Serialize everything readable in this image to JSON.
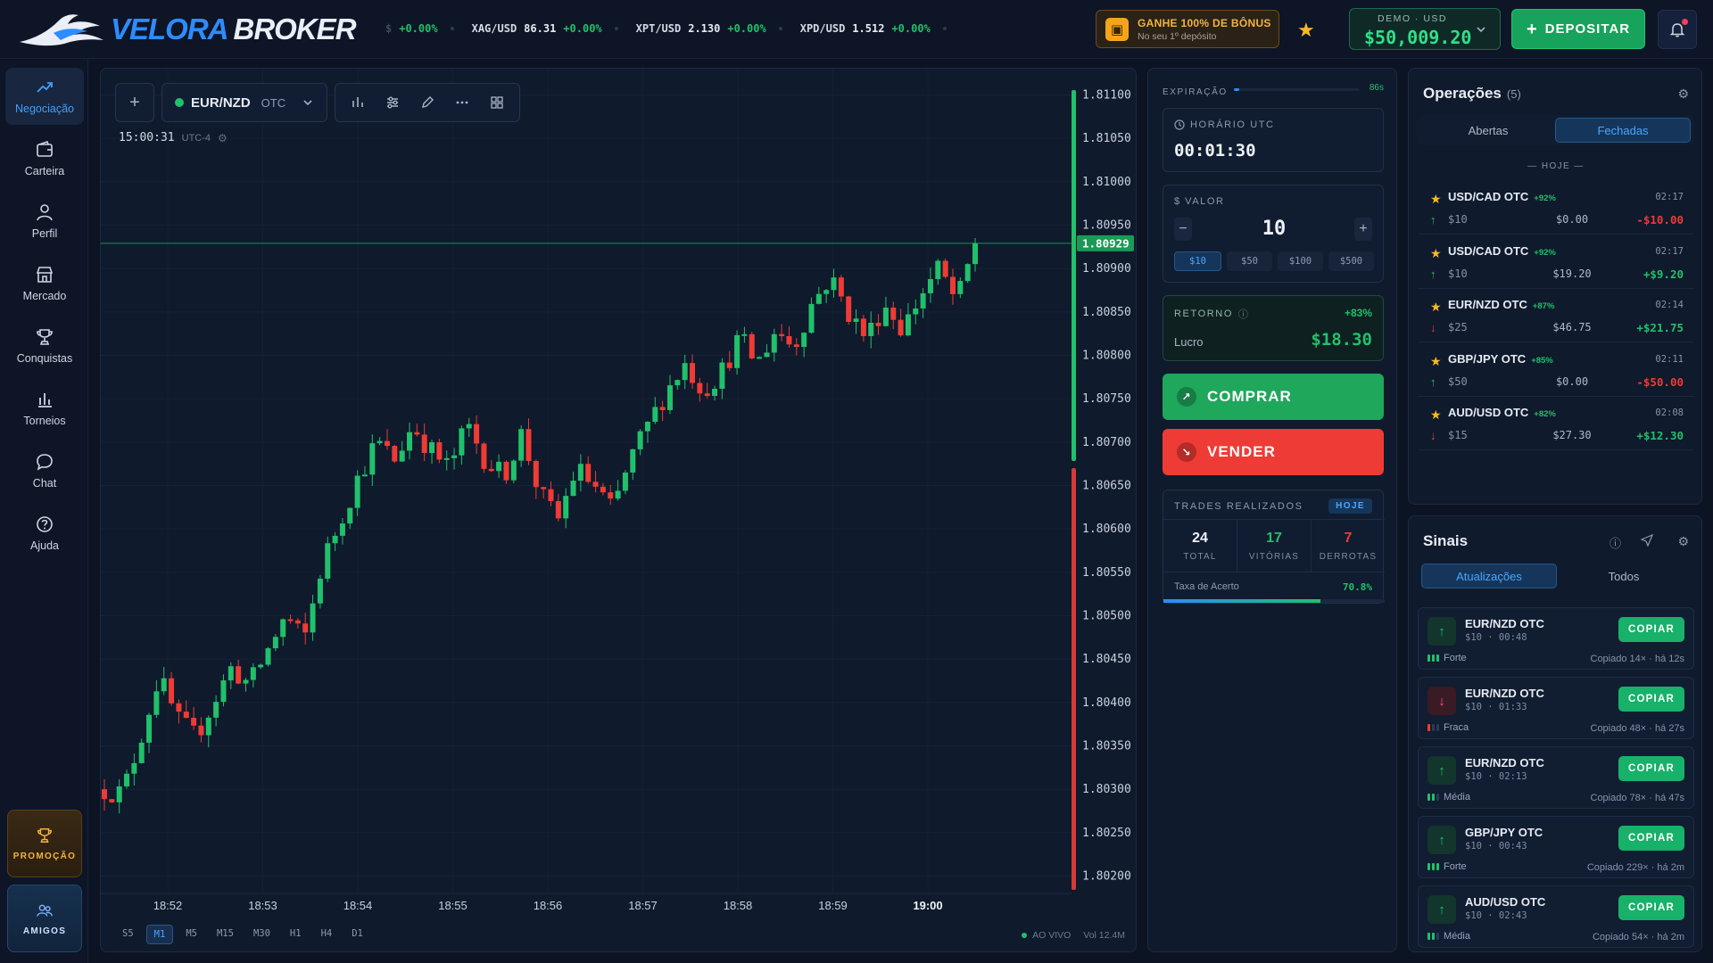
{
  "brand": {
    "part1": "VELORA",
    "part2": "BROKER"
  },
  "ticker": [
    {
      "symbol": "",
      "price": "$",
      "change": "+0.00%"
    },
    {
      "symbol": "XAG/USD",
      "price": "86.31",
      "change": "+0.00%"
    },
    {
      "symbol": "XPT/USD",
      "price": "2.130",
      "change": "+0.00%"
    },
    {
      "symbol": "XPD/USD",
      "price": "1.512",
      "change": "+0.00%"
    }
  ],
  "bonus": {
    "title": "GANHE 100% DE BÔNUS",
    "subtitle": "No seu 1º depósito"
  },
  "account": {
    "label": "DEMO · USD",
    "balance": "$50,009.20"
  },
  "deposit_label": "DEPOSITAR",
  "nav": [
    {
      "label": "Negociação",
      "icon": "trend-up-icon",
      "active": true
    },
    {
      "label": "Carteira",
      "icon": "wallet-icon"
    },
    {
      "label": "Perfil",
      "icon": "user-icon"
    },
    {
      "label": "Mercado",
      "icon": "store-icon"
    },
    {
      "label": "Conquistas",
      "icon": "trophy-icon"
    },
    {
      "label": "Torneios",
      "icon": "bar-chart-icon"
    },
    {
      "label": "Chat",
      "icon": "chat-icon"
    },
    {
      "label": "Ajuda",
      "icon": "help-icon"
    }
  ],
  "promo": {
    "promotion": "PROMOÇÃO",
    "friends": "AMIGOS"
  },
  "chart_toolbar": {
    "pair": "EUR/NZD",
    "market": "OTC"
  },
  "chart_clock": {
    "time": "15:00:31",
    "tz": "UTC-4"
  },
  "timeframes": [
    "S5",
    "M1",
    "M5",
    "M15",
    "M30",
    "H1",
    "H4",
    "D1"
  ],
  "active_timeframe": "M1",
  "live": {
    "label": "AO VIVO",
    "volume": "Vol 12.4M"
  },
  "chart_data": {
    "type": "candlestick",
    "x_ticks": [
      "18:52",
      "18:53",
      "18:54",
      "18:55",
      "18:56",
      "18:57",
      "18:58",
      "18:59",
      "19:00"
    ],
    "y_ticks": [
      "1.81100",
      "1.81050",
      "1.81000",
      "1.80950",
      "1.80900",
      "1.80850",
      "1.80800",
      "1.80750",
      "1.80700",
      "1.80650",
      "1.80600",
      "1.80550",
      "1.80500",
      "1.80450",
      "1.80400",
      "1.80350",
      "1.80300",
      "1.80250",
      "1.80200"
    ],
    "ylim": [
      1.8018,
      1.8112
    ],
    "current_price": "1.80929",
    "current_value": 1.80929,
    "buy_ratio": 0.47,
    "close_path": [
      1.803,
      1.80295,
      1.8036,
      1.8043,
      1.8038,
      1.8036,
      1.804,
      1.8044,
      1.8042,
      1.8046,
      1.805,
      1.8047,
      1.8056,
      1.8061,
      1.8066,
      1.807,
      1.8068,
      1.8072,
      1.8069,
      1.8067,
      1.8072,
      1.8068,
      1.8066,
      1.8071,
      1.8064,
      1.8061,
      1.8067,
      1.8065,
      1.8062,
      1.8068,
      1.8072,
      1.8076,
      1.8079,
      1.8076,
      1.8078,
      1.8082,
      1.8079,
      1.8083,
      1.8081,
      1.8086,
      1.8089,
      1.8085,
      1.8082,
      1.8086,
      1.8083,
      1.8087,
      1.809,
      1.8086,
      1.80929
    ]
  },
  "trade": {
    "expiration_label": "EXPIRAÇÃO",
    "expiration_value": "86s",
    "expiration_fill": 0.04,
    "utc_label": "HORÁRIO UTC",
    "utc_time": "00:01:30",
    "value_label": "VALOR",
    "amount": "10",
    "presets": [
      "$10",
      "$50",
      "$100",
      "$500"
    ],
    "return_label": "RETORNO",
    "return_pct": "+83%",
    "profit_label": "Lucro",
    "profit": "$18.30",
    "buy": "COMPRAR",
    "sell": "VENDER",
    "stats_label": "TRADES REALIZADOS",
    "stats_period": "HOJE",
    "total": "24",
    "total_label": "TOTAL",
    "wins": "17",
    "wins_label": "VITÓRIAS",
    "losses": "7",
    "losses_label": "DERROTAS",
    "accuracy_label": "Taxa de Acerto",
    "accuracy": "70.8%",
    "accuracy_fill": 0.708
  },
  "operations": {
    "title": "Operações",
    "count": "(5)",
    "tabs": [
      "Abertas",
      "Fechadas"
    ],
    "active_tab": "Fechadas",
    "day": "— HOJE —",
    "items": [
      {
        "pair": "USD/CAD OTC",
        "pct": "+92%",
        "time": "02:17",
        "dir": "up",
        "amount": "$10",
        "payout": "$0.00",
        "result": "-$10.00"
      },
      {
        "pair": "USD/CAD OTC",
        "pct": "+92%",
        "time": "02:17",
        "dir": "up",
        "amount": "$10",
        "payout": "$19.20",
        "result": "+$9.20"
      },
      {
        "pair": "EUR/NZD OTC",
        "pct": "+87%",
        "time": "02:14",
        "dir": "down",
        "amount": "$25",
        "payout": "$46.75",
        "result": "+$21.75"
      },
      {
        "pair": "GBP/JPY OTC",
        "pct": "+85%",
        "time": "02:11",
        "dir": "up",
        "amount": "$50",
        "payout": "$0.00",
        "result": "-$50.00"
      },
      {
        "pair": "AUD/USD OTC",
        "pct": "+82%",
        "time": "02:08",
        "dir": "down",
        "amount": "$15",
        "payout": "$27.30",
        "result": "+$12.30"
      }
    ]
  },
  "signals": {
    "title": "Sinais",
    "tabs": [
      "Atualizações",
      "Todos"
    ],
    "active_tab": "Atualizações",
    "copy_label": "COPIAR",
    "items": [
      {
        "pair": "EUR/NZD OTC",
        "meta": "$10 · 00:48",
        "dir": "up",
        "strength": "Forte",
        "level": 3,
        "copied": "Copiado 14× · há 12s"
      },
      {
        "pair": "EUR/NZD OTC",
        "meta": "$10 · 01:33",
        "dir": "down",
        "strength": "Fraca",
        "level": 1,
        "copied": "Copiado 48× · há 27s"
      },
      {
        "pair": "EUR/NZD OTC",
        "meta": "$10 · 02:13",
        "dir": "up",
        "strength": "Média",
        "level": 2,
        "copied": "Copiado 78× · há 47s"
      },
      {
        "pair": "GBP/JPY OTC",
        "meta": "$10 · 00:43",
        "dir": "up",
        "strength": "Forte",
        "level": 3,
        "copied": "Copiado 229× · há 2m"
      },
      {
        "pair": "AUD/USD OTC",
        "meta": "$10 · 02:43",
        "dir": "up",
        "strength": "Média",
        "level": 2,
        "copied": "Copiado 54× · há 2m"
      }
    ]
  },
  "colors": {
    "up": "#21c06b",
    "down": "#ef3b35",
    "accent": "#2d8cff",
    "gold": "#f7b928"
  }
}
